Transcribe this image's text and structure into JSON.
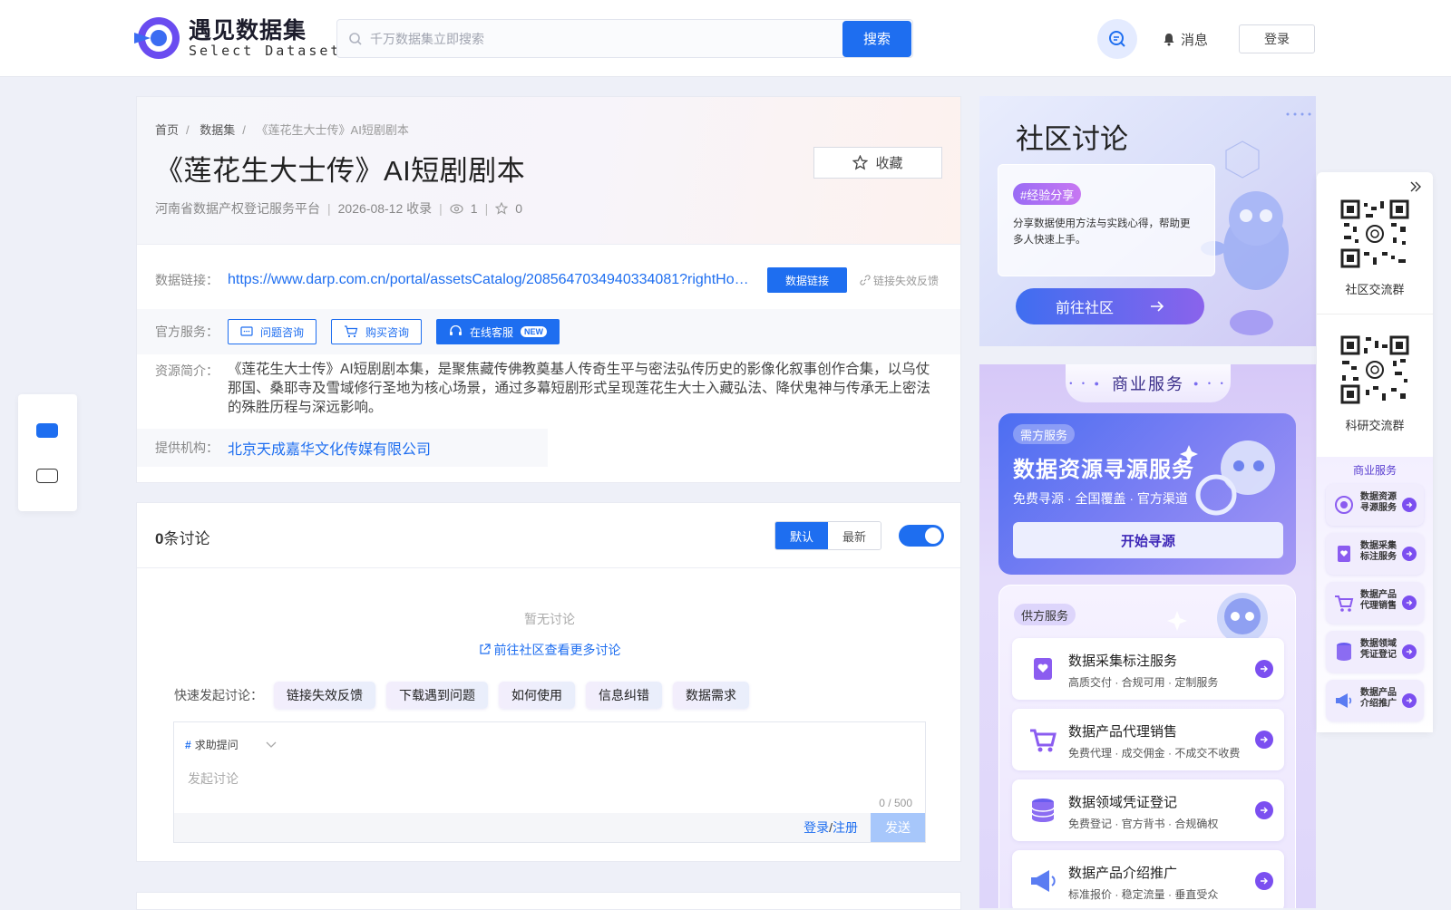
{
  "header": {
    "logo_cn": "遇见数据集",
    "logo_en": "Select Dataset",
    "search_placeholder": "千万数据集立即搜索",
    "search_button": "搜索",
    "messages": "消息",
    "login": "登录"
  },
  "breadcrumb": [
    "首页",
    "数据集",
    "《莲花生大士传》AI短剧剧本"
  ],
  "dataset": {
    "title": "《莲花生大士传》AI短剧剧本",
    "favorite": "收藏",
    "source": "河南省数据产权登记服务平台",
    "collected": "2026-08-12 收录",
    "views": "1",
    "stars": "0",
    "link_label": "数据链接：",
    "link": "https://www.darp.com.cn/portal/assetsCatalog/2085647034940334081?rightHo…",
    "link_button": "数据链接",
    "link_fail": "链接失效反馈",
    "service_label": "官方服务：",
    "services": [
      "问题咨询",
      "购买咨询",
      "在线客服"
    ],
    "new_badge": "NEW",
    "intro_label": "资源简介：",
    "intro": "《莲花生大士传》AI短剧剧本集，是聚焦藏传佛教奠基人传奇生平与密法弘传历史的影像化叙事创作合集，以乌仗那国、桑耶寺及雪域修行圣地为核心场景，通过多幕短剧形式呈现莲花生大士入藏弘法、降伏鬼神与传承无上密法的殊胜历程与深远影响。",
    "org_label": "提供机构：",
    "org": "北京天成嘉华文化传媒有限公司"
  },
  "discussion": {
    "count": "0",
    "count_suffix": "条讨论",
    "sort": [
      "默认",
      "最新"
    ],
    "empty": "暂无讨论",
    "more": "前往社区查看更多讨论",
    "quick_label": "快速发起讨论：",
    "quick": [
      "链接失效反馈",
      "下载遇到问题",
      "如何使用",
      "信息纠错",
      "数据需求"
    ],
    "tag": "求助提问",
    "placeholder": "发起讨论",
    "counter": "0 / 500",
    "login": "登录",
    "slash": "/",
    "register": "注册",
    "send": "发送"
  },
  "community": {
    "title": "社区讨论",
    "tag": "#经验分享",
    "desc": "分享数据使用方法与实践心得，帮助更多人快速上手。",
    "button": "前往社区"
  },
  "business": {
    "title": "商业服务",
    "need_tag": "需方服务",
    "need_title": "数据资源寻源服务",
    "need_sub": "免费寻源 · 全国覆盖 · 官方渠道",
    "need_button": "开始寻源",
    "supply_tag": "供方服务",
    "supply": [
      {
        "title": "数据采集标注服务",
        "sub": "高质交付 · 合规可用 · 定制服务"
      },
      {
        "title": "数据产品代理销售",
        "sub": "免费代理 · 成交佣金 · 不成交不收费"
      },
      {
        "title": "数据领域凭证登记",
        "sub": "免费登记 · 官方背书 · 合规确权"
      },
      {
        "title": "数据产品介绍推广",
        "sub": "标准报价 · 稳定流量 · 垂直受众"
      }
    ]
  },
  "rail": {
    "qr1": "社区交流群",
    "qr2": "科研交流群",
    "biz_title": "商业服务",
    "items": [
      "数据资源寻源服务",
      "数据采集标注服务",
      "数据产品代理销售",
      "数据领域凭证登记",
      "数据产品介绍推广"
    ]
  },
  "colors": {
    "accent": "#1e6ef0",
    "purple": "#7b4ff0"
  }
}
